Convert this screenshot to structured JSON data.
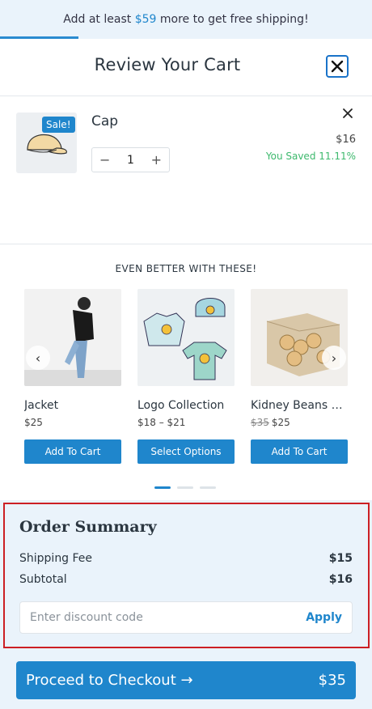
{
  "banner": {
    "prefix": "Add at least ",
    "amount": "$59",
    "suffix": " more to get free shipping!",
    "progress": 0.21
  },
  "cart": {
    "title": "Review Your Cart"
  },
  "item": {
    "name": "Cap",
    "badge": "Sale!",
    "quantity": "1",
    "minus": "−",
    "plus": "+",
    "price": "$16",
    "saved": "You Saved 11.11%"
  },
  "upsell": {
    "title": "EVEN BETTER WITH THESE!",
    "prev": "‹",
    "next": "›",
    "products": [
      {
        "name": "Jacket",
        "price": "$25",
        "button": "Add To Cart"
      },
      {
        "name": "Logo Collection",
        "price": "$18 – $21",
        "button": "Select Options"
      },
      {
        "name": "Kidney Beans Or...",
        "price_old": "$35",
        "price": "$25",
        "button": "Add To Cart"
      }
    ]
  },
  "summary": {
    "title": "Order Summary",
    "shipping_label": "Shipping Fee",
    "shipping_value": "$15",
    "subtotal_label": "Subtotal",
    "subtotal_value": "$16",
    "discount_placeholder": "Enter discount code",
    "apply_label": "Apply"
  },
  "checkout": {
    "label": "Proceed to Checkout →",
    "total": "$35"
  },
  "colors": {
    "accent": "#1f86cc",
    "saved": "#3db96d",
    "highlight": "#cc1f24"
  }
}
